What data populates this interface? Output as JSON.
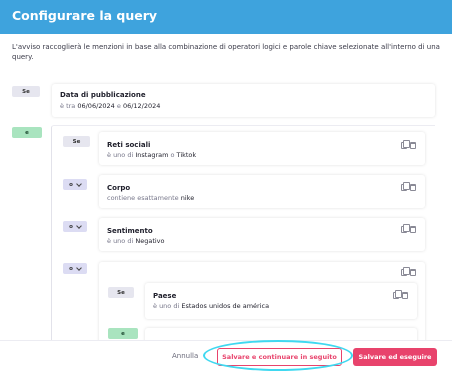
{
  "header": {
    "title": "Configurare la query"
  },
  "description": "L'avviso raccoglierà le menzioni in base alla combinazione di operatori logici e parole chiave selezionate all'interno di una query.",
  "tags": {
    "se": "Se",
    "e": "e",
    "o": "o"
  },
  "conditions": [
    {
      "title": "Data di pubblicazione",
      "prefix": "è tra ",
      "value1": "06/06/2024",
      "joiner": " e ",
      "value2": "06/12/2024"
    },
    {
      "title": "Reti sociali",
      "prefix": "è uno di ",
      "value1": "Instagram",
      "joiner": " o ",
      "value2": "Tiktok"
    },
    {
      "title": "Corpo",
      "prefix": "contiene esattamente ",
      "value1": "nike"
    },
    {
      "title": "Sentimento",
      "prefix": "è uno di ",
      "value1": "Negativo"
    },
    {
      "title": "Paese",
      "prefix": "è uno di ",
      "value1": "Estados unidos de américa"
    }
  ],
  "footer": {
    "cancel_label": "Annulla",
    "save_later_label": "Salvare e continuare in seguito",
    "save_run_label": "Salvare ed eseguire"
  },
  "colors": {
    "header": "#3ea3dd",
    "accent": "#e8436c",
    "highlight": "#3fd8f0",
    "and_tag": "#a9e4bf"
  }
}
